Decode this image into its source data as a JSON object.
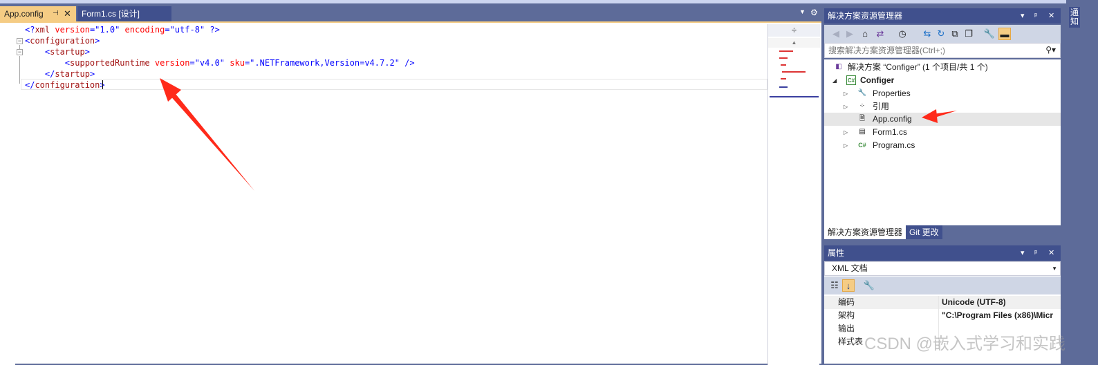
{
  "tabs": [
    {
      "label": "App.config",
      "active": true,
      "pin": "⊣",
      "close": "✕"
    },
    {
      "label": "Form1.cs [设计]",
      "active": false
    }
  ],
  "editor": {
    "lines": [
      {
        "indent": "",
        "parts": [
          {
            "t": "<?",
            "c": "blue"
          },
          {
            "t": "xml",
            "c": "maroon"
          },
          {
            "t": " ",
            "c": ""
          },
          {
            "t": "version",
            "c": "red"
          },
          {
            "t": "=\"",
            "c": "blue"
          },
          {
            "t": "1.0",
            "c": "blue"
          },
          {
            "t": "\" ",
            "c": "blue"
          },
          {
            "t": "encoding",
            "c": "red"
          },
          {
            "t": "=\"",
            "c": "blue"
          },
          {
            "t": "utf-8",
            "c": "blue"
          },
          {
            "t": "\" ",
            "c": "blue"
          },
          {
            "t": "?>",
            "c": "blue"
          }
        ]
      },
      {
        "indent": "",
        "parts": [
          {
            "t": "<",
            "c": "blue"
          },
          {
            "t": "configuration",
            "c": "maroon"
          },
          {
            "t": ">",
            "c": "blue"
          }
        ]
      },
      {
        "indent": "    ",
        "parts": [
          {
            "t": "<",
            "c": "blue"
          },
          {
            "t": "startup",
            "c": "maroon"
          },
          {
            "t": ">",
            "c": "blue"
          }
        ]
      },
      {
        "indent": "        ",
        "parts": [
          {
            "t": "<",
            "c": "blue"
          },
          {
            "t": "supportedRuntime",
            "c": "maroon"
          },
          {
            "t": " ",
            "c": ""
          },
          {
            "t": "version",
            "c": "red"
          },
          {
            "t": "=\"",
            "c": "blue"
          },
          {
            "t": "v4.0",
            "c": "blue"
          },
          {
            "t": "\" ",
            "c": "blue"
          },
          {
            "t": "sku",
            "c": "red"
          },
          {
            "t": "=\"",
            "c": "blue"
          },
          {
            "t": ".NETFramework,Version=v4.7.2",
            "c": "blue"
          },
          {
            "t": "\" ",
            "c": "blue"
          },
          {
            "t": "/>",
            "c": "blue"
          }
        ]
      },
      {
        "indent": "    ",
        "parts": [
          {
            "t": "</",
            "c": "blue"
          },
          {
            "t": "startup",
            "c": "maroon"
          },
          {
            "t": ">",
            "c": "blue"
          }
        ]
      },
      {
        "indent": "",
        "parts": [
          {
            "t": "</",
            "c": "blue"
          },
          {
            "t": "configuration",
            "c": "maroon"
          },
          {
            "t": ">",
            "c": "blue"
          }
        ]
      }
    ]
  },
  "solution_explorer": {
    "title": "解决方案资源管理器",
    "search_placeholder": "搜索解决方案资源管理器(Ctrl+;)",
    "tree": [
      {
        "label": "解决方案 “Configer” (1 个项目/共 1 个)",
        "icon": "solution-icon",
        "level": 0,
        "twisty": ""
      },
      {
        "label": "Configer",
        "icon": "csharp-project-icon",
        "level": 0,
        "twisty": "◢",
        "bold": true
      },
      {
        "label": "Properties",
        "icon": "wrench-icon",
        "level": 1,
        "twisty": "▷"
      },
      {
        "label": "引用",
        "icon": "references-icon",
        "level": 1,
        "twisty": "▷"
      },
      {
        "label": "App.config",
        "icon": "config-file-icon",
        "level": 1,
        "twisty": "",
        "selected": true
      },
      {
        "label": "Form1.cs",
        "icon": "form-icon",
        "level": 1,
        "twisty": "▷"
      },
      {
        "label": "Program.cs",
        "icon": "csharp-file-icon",
        "level": 1,
        "twisty": "▷"
      }
    ],
    "bottom_tabs": [
      "解决方案资源管理器",
      "Git 更改"
    ]
  },
  "properties": {
    "title": "属性",
    "object": "XML 文档",
    "rows": [
      {
        "key": "编码",
        "value": "Unicode (UTF-8)"
      },
      {
        "key": "架构",
        "value": "\"C:\\Program Files (x86)\\Micr"
      },
      {
        "key": "输出",
        "value": ""
      },
      {
        "key": "样式表",
        "value": ""
      }
    ]
  },
  "right_strip_label": "通知",
  "watermark": "CSDN @嵌入式学习和实践",
  "colors": {
    "accent": "#f5cc84",
    "chrome": "#5d6b99",
    "arrow": "#ff2a1a"
  }
}
